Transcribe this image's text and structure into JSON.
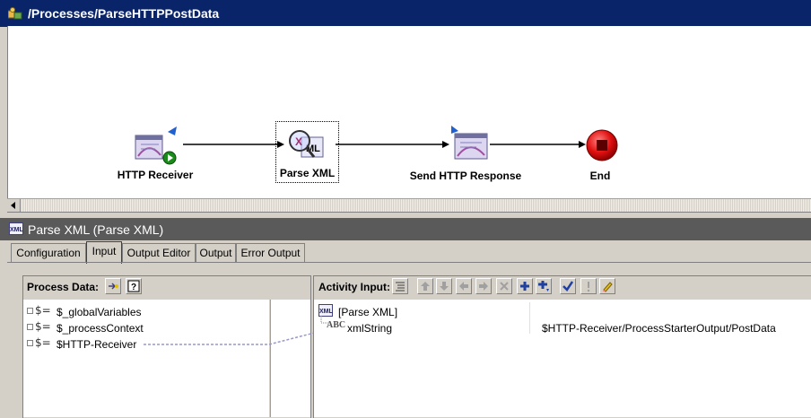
{
  "window": {
    "title": "/Processes/ParseHTTPPostData"
  },
  "nodes": [
    {
      "id": "http-receiver",
      "label": "HTTP Receiver"
    },
    {
      "id": "parse-xml",
      "label": "Parse XML"
    },
    {
      "id": "send-http-response",
      "label": "Send HTTP Response"
    },
    {
      "id": "end",
      "label": "End"
    }
  ],
  "panel": {
    "title": "Parse XML (Parse XML)"
  },
  "tabs": [
    {
      "label": "Configuration",
      "active": false
    },
    {
      "label": "Input",
      "active": true
    },
    {
      "label": "Output Editor",
      "active": false
    },
    {
      "label": "Output",
      "active": false
    },
    {
      "label": "Error Output",
      "active": false
    }
  ],
  "process_data": {
    "label": "Process Data:",
    "items": [
      "$_globalVariables",
      "$_processContext",
      "$HTTP-Receiver"
    ]
  },
  "activity_input": {
    "label": "Activity Input:",
    "root": "[Parse XML]",
    "row": {
      "name": "xmlString",
      "value": "$HTTP-Receiver/ProcessStarterOutput/PostData"
    }
  },
  "colors": {
    "titlebar": "#0a246a",
    "panel_header": "#5a5a5a",
    "end_node": "#e01010",
    "mapping_line": "#9999cc"
  }
}
